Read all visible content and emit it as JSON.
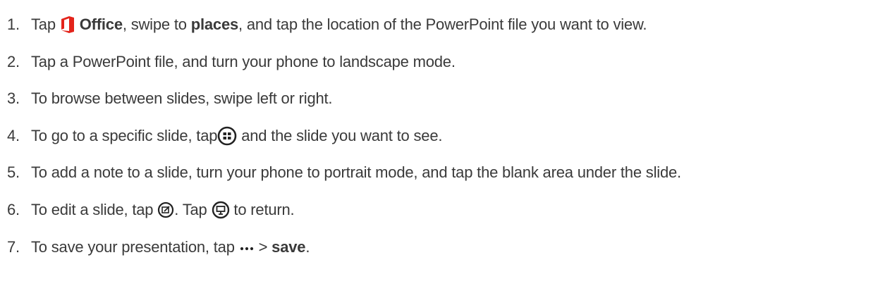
{
  "steps": [
    {
      "number": "1.",
      "pre_icon": "Tap",
      "icon": "office-logo-icon",
      "b1": "Office",
      "t1": ", swipe to",
      "b2": "places",
      "t2": ", and tap the location of the PowerPoint file you want to view."
    },
    {
      "number": "2.",
      "text": "Tap a PowerPoint file, and turn your phone to landscape mode."
    },
    {
      "number": "3.",
      "text": "To browse between slides, swipe left or right."
    },
    {
      "number": "4.",
      "pre_icon": "To go to a specific slide, tap",
      "icon": "slide-thumbnails-icon",
      "post_icon": "and the slide you want to see."
    },
    {
      "number": "5.",
      "text": "To add a note to a slide, turn your phone to portrait mode, and tap the blank area under the slide."
    },
    {
      "number": "6.",
      "pre_icon": "To edit a slide, tap",
      "icon": "edit-icon",
      "mid": ". Tap",
      "icon2": "presentation-view-icon",
      "post_icon": "to return."
    },
    {
      "number": "7.",
      "pre_icon": "To save your presentation, tap",
      "icon": "more-ellipsis-icon",
      "mid": ">",
      "b1": "save",
      "post": "."
    }
  ],
  "colors": {
    "text": "#3a3a3a",
    "office_red": "#e3241b",
    "icon_stroke": "#333333"
  }
}
